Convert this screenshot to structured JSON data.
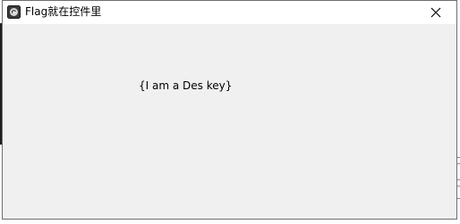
{
  "window": {
    "title": "Flag就在控件里",
    "app_icon": "app-icon",
    "close_icon": "close-icon"
  },
  "content": {
    "label_text": "{I am a Des key}"
  }
}
